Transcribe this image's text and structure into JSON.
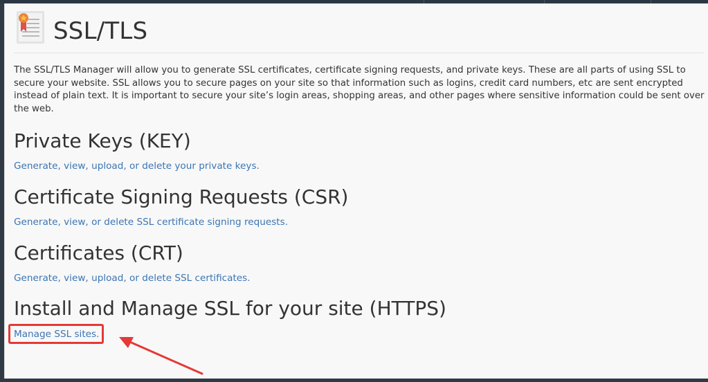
{
  "page": {
    "title": "SSL/TLS",
    "icon": "certificate-icon",
    "intro": "The SSL/TLS Manager will allow you to generate SSL certificates, certificate signing requests, and private keys. These are all parts of using SSL to secure your website. SSL allows you to secure pages on your site so that information such as logins, credit card numbers, etc are sent encrypted instead of plain text. It is important to secure your site’s login areas, shopping areas, and other pages where sensitive information could be sent over the web."
  },
  "sections": [
    {
      "title": "Private Keys (KEY)",
      "link": "Generate, view, upload, or delete your private keys."
    },
    {
      "title": "Certificate Signing Requests (CSR)",
      "link": "Generate, view, or delete SSL certificate signing requests."
    },
    {
      "title": "Certificates (CRT)",
      "link": "Generate, view, upload, or delete SSL certificates."
    },
    {
      "title": "Install and Manage SSL for your site (HTTPS)",
      "link": "Manage SSL sites."
    }
  ],
  "annotation": {
    "highlight_color": "#e53935",
    "arrow_icon": "red-arrow-icon"
  },
  "colors": {
    "link": "#3b75b3",
    "text": "#333333",
    "background": "#f8f8f8"
  }
}
